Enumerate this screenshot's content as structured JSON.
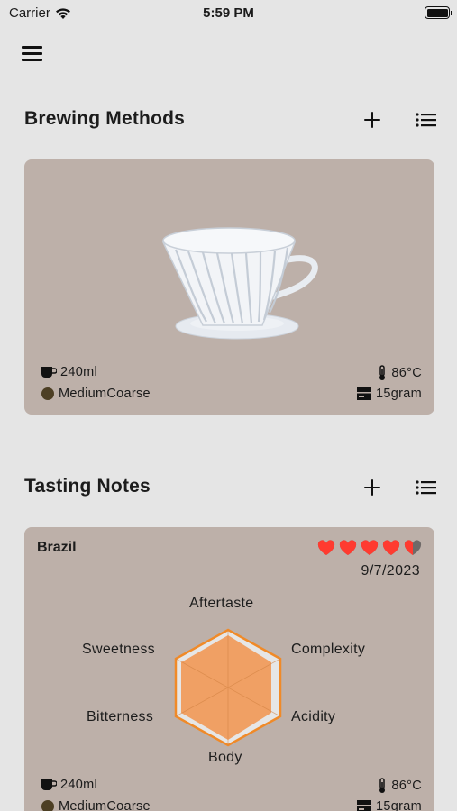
{
  "status_bar": {
    "carrier": "Carrier",
    "time": "5:59 PM"
  },
  "brewing": {
    "title": "Brewing Methods",
    "card": {
      "water_volume": "240ml",
      "grind_size": "MediumCoarse",
      "temperature": "86°C",
      "coffee_weight": "15gram"
    }
  },
  "tasting": {
    "title": "Tasting Notes",
    "card": {
      "name": "Brazil",
      "date": "9/7/2023",
      "rating": 4.5,
      "labels": {
        "aftertaste": "Aftertaste",
        "complexity": "Complexity",
        "acidity": "Acidity",
        "body": "Body",
        "bitterness": "Bitterness",
        "sweetness": "Sweetness"
      },
      "water_volume": "240ml",
      "grind_size": "MediumCoarse",
      "temperature": "86°C",
      "coffee_weight": "15gram"
    }
  },
  "colors": {
    "card_bg": "#bdb0a9",
    "heart": "#ff3b30",
    "radar_fill": "#f0a064",
    "radar_stroke": "#f08a28"
  }
}
